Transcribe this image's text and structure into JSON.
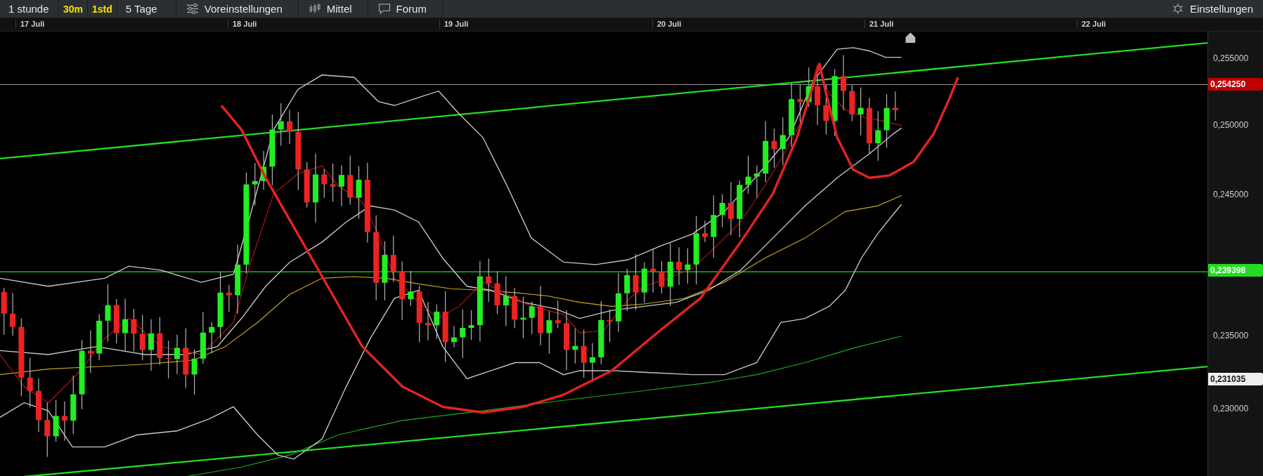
{
  "toolbar": {
    "items": [
      {
        "label": "1 stunde",
        "kind": "dropdown"
      },
      {
        "label": "30m",
        "kind": "shortcut"
      },
      {
        "label": "1std",
        "kind": "shortcut"
      },
      {
        "label": "5 Tage",
        "kind": "dropdown"
      },
      {
        "label": "Voreinstellungen",
        "kind": "button"
      },
      {
        "label": "Mittel",
        "kind": "button"
      },
      {
        "label": "Forum",
        "kind": "button"
      }
    ],
    "settings": {
      "label": "Einstellungen"
    }
  },
  "date_axis": {
    "labels": [
      "17 Juli",
      "18 Juli",
      "19 Juli",
      "20 Juli",
      "21 Juli",
      "22 Juli"
    ]
  },
  "price_axis": {
    "ticks": [
      "0,255000",
      "0,250000",
      "0,245000",
      "0,235000",
      "0,230000"
    ],
    "markers": [
      {
        "label": "0,254250",
        "color": "#c00000"
      },
      {
        "label": "0,239398",
        "color": "#22dd22"
      },
      {
        "label": "0,231035",
        "color": "#eeeeee"
      }
    ]
  }
}
